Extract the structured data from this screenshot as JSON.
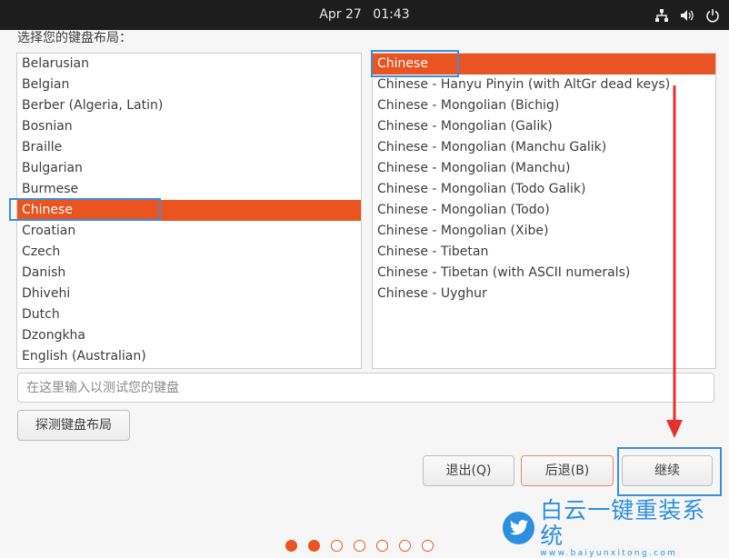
{
  "topbar": {
    "date": "Apr 27",
    "time": "01:43",
    "icons": [
      "network-icon",
      "volume-icon",
      "power-icon"
    ]
  },
  "prompt": "选择您的键盘布局：",
  "left_list": {
    "items": [
      "Belarusian",
      "Belgian",
      "Berber (Algeria, Latin)",
      "Bosnian",
      "Braille",
      "Bulgarian",
      "Burmese",
      "Chinese",
      "Croatian",
      "Czech",
      "Danish",
      "Dhivehi",
      "Dutch",
      "Dzongkha",
      "English (Australian)"
    ],
    "selected": "Chinese"
  },
  "right_list": {
    "items": [
      "Chinese",
      "Chinese - Hanyu Pinyin (with AltGr dead keys)",
      "Chinese - Mongolian (Bichig)",
      "Chinese - Mongolian (Galik)",
      "Chinese - Mongolian (Manchu Galik)",
      "Chinese - Mongolian (Manchu)",
      "Chinese - Mongolian (Todo Galik)",
      "Chinese - Mongolian (Todo)",
      "Chinese - Mongolian (Xibe)",
      "Chinese - Tibetan",
      "Chinese - Tibetan (with ASCII numerals)",
      "Chinese - Uyghur"
    ],
    "selected": "Chinese"
  },
  "test_input": {
    "placeholder": "在这里输入以测试您的键盘",
    "value": ""
  },
  "buttons": {
    "detect": "探测键盘布局",
    "quit": "退出(Q)",
    "back": "后退(B)",
    "continue": "继续"
  },
  "progress": {
    "total_steps": 7,
    "completed_steps": 2
  },
  "colors": {
    "accent": "#e95420",
    "topbar": "#1d1d1d",
    "annotation_box": "#3a8edc",
    "annotation_arrow": "#e8312f",
    "watermark": "#2d8fe0"
  },
  "watermark": {
    "text": "白云一键重装系统",
    "url": "www.baiyunxitong.com",
    "icon": "twitter-bird-icon"
  }
}
